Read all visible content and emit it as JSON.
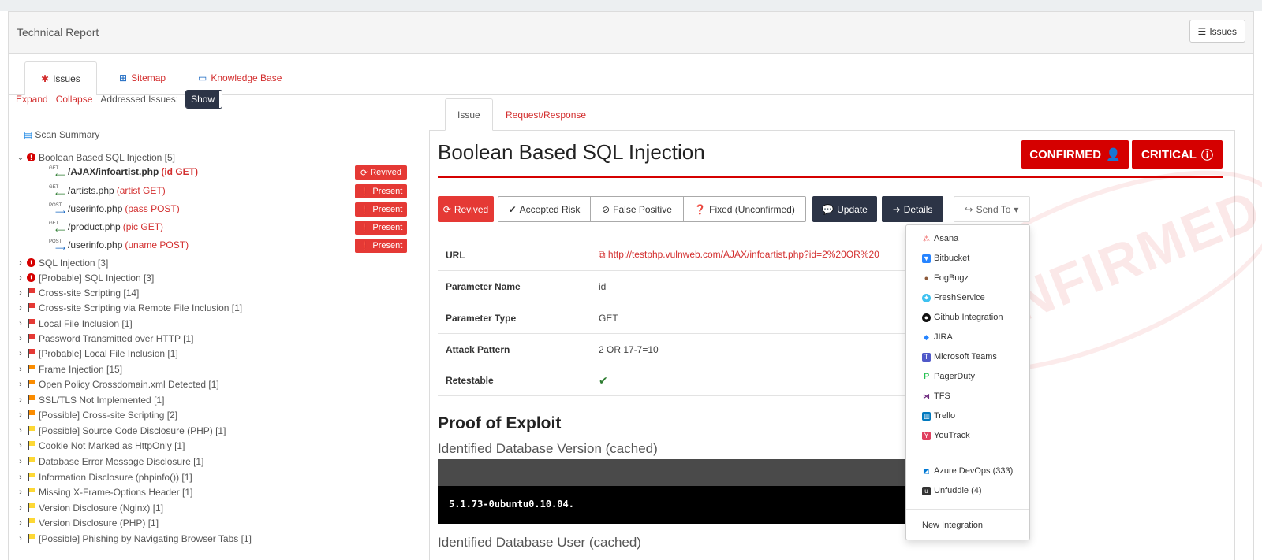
{
  "header": {
    "title": "Technical Report",
    "issues_button": "Issues"
  },
  "main_tabs": [
    {
      "label": "Issues"
    },
    {
      "label": "Sitemap"
    },
    {
      "label": "Knowledge Base"
    }
  ],
  "tree_controls": {
    "expand": "Expand",
    "collapse": "Collapse",
    "addressed_label": "Addressed Issues:",
    "show": "Show"
  },
  "scan_summary": "Scan Summary",
  "tree": [
    {
      "label": "Boolean Based SQL Injection [5]",
      "icon": "error",
      "expanded": true
    },
    {
      "label": "SQL Injection [3]",
      "icon": "error"
    },
    {
      "label": "[Probable] SQL Injection [3]",
      "icon": "error"
    },
    {
      "label": "Cross-site Scripting [14]",
      "icon": "red-flag"
    },
    {
      "label": "Cross-site Scripting via Remote File Inclusion [1]",
      "icon": "red-flag"
    },
    {
      "label": "Local File Inclusion [1]",
      "icon": "red-flag"
    },
    {
      "label": "Password Transmitted over HTTP [1]",
      "icon": "red-flag"
    },
    {
      "label": "[Probable] Local File Inclusion [1]",
      "icon": "red-flag"
    },
    {
      "label": "Frame Injection [15]",
      "icon": "orange-flag"
    },
    {
      "label": "Open Policy Crossdomain.xml Detected [1]",
      "icon": "orange-flag"
    },
    {
      "label": "SSL/TLS Not Implemented [1]",
      "icon": "orange-flag"
    },
    {
      "label": "[Possible] Cross-site Scripting [2]",
      "icon": "orange-flag"
    },
    {
      "label": "[Possible] Source Code Disclosure (PHP) [1]",
      "icon": "yellow-flag"
    },
    {
      "label": "Cookie Not Marked as HttpOnly [1]",
      "icon": "yellow-flag"
    },
    {
      "label": "Database Error Message Disclosure [1]",
      "icon": "yellow-flag"
    },
    {
      "label": "Information Disclosure (phpinfo()) [1]",
      "icon": "yellow-flag"
    },
    {
      "label": "Missing X-Frame-Options Header [1]",
      "icon": "yellow-flag"
    },
    {
      "label": "Version Disclosure (Nginx) [1]",
      "icon": "yellow-flag"
    },
    {
      "label": "Version Disclosure (PHP) [1]",
      "icon": "yellow-flag"
    },
    {
      "label": "[Possible] Phishing by Navigating Browser Tabs [1]",
      "icon": "yellow-flag"
    }
  ],
  "sub_items": [
    {
      "method": "GET",
      "path": "/AJAX/infoartist.php",
      "param": "(id GET)",
      "status": "Revived"
    },
    {
      "method": "GET",
      "path": "/artists.php",
      "param": "(artist GET)",
      "status": "Present"
    },
    {
      "method": "POST",
      "path": "/userinfo.php",
      "param": "(pass POST)",
      "status": "Present"
    },
    {
      "method": "GET",
      "path": "/product.php",
      "param": "(pic GET)",
      "status": "Present"
    },
    {
      "method": "POST",
      "path": "/userinfo.php",
      "param": "(uname POST)",
      "status": "Present"
    }
  ],
  "right_tabs": [
    {
      "label": "Issue"
    },
    {
      "label": "Request/Response"
    }
  ],
  "issue": {
    "title": "Boolean Based SQL Injection",
    "confirmed": "CONFIRMED",
    "severity": "CRITICAL",
    "stamp": "CONFIRMED"
  },
  "actions": {
    "revived": "Revived",
    "accepted_risk": "Accepted Risk",
    "false_positive": "False Positive",
    "fixed": "Fixed (Unconfirmed)",
    "update": "Update",
    "details": "Details",
    "send_to": "Send To"
  },
  "info": [
    {
      "key": "URL",
      "value": "http://testphp.vulnweb.com/AJAX/infoartist.php?id=2%20OR%20"
    },
    {
      "key": "Parameter Name",
      "value": "id"
    },
    {
      "key": "Parameter Type",
      "value": "GET"
    },
    {
      "key": "Attack Pattern",
      "value": "2 OR 17-7=10"
    },
    {
      "key": "Retestable",
      "value": "✔"
    }
  ],
  "proof": {
    "title": "Proof of Exploit",
    "db_version_label": "Identified Database Version (cached)",
    "db_version": "5.1.73-0ubuntu0.10.04.",
    "db_user_label": "Identified Database User (cached)"
  },
  "send_to_menu": {
    "integrations": [
      {
        "label": "Asana",
        "color": "#f06a6a"
      },
      {
        "label": "Bitbucket",
        "color": "#2684ff"
      },
      {
        "label": "FogBugz",
        "color": "#8d5a3b"
      },
      {
        "label": "FreshService",
        "color": "#3ec1f0"
      },
      {
        "label": "Github Integration",
        "color": "#111111"
      },
      {
        "label": "JIRA",
        "color": "#2684ff"
      },
      {
        "label": "Microsoft Teams",
        "color": "#5059c9"
      },
      {
        "label": "PagerDuty",
        "color": "#25c151"
      },
      {
        "label": "TFS",
        "color": "#68217a"
      },
      {
        "label": "Trello",
        "color": "#0079bf"
      },
      {
        "label": "YouTrack",
        "color": "#e04060"
      }
    ],
    "configured": [
      {
        "label": "Azure DevOps (333)",
        "color": "#0078d4"
      },
      {
        "label": "Unfuddle (4)",
        "color": "#333333"
      }
    ],
    "new_integration": "New Integration"
  }
}
